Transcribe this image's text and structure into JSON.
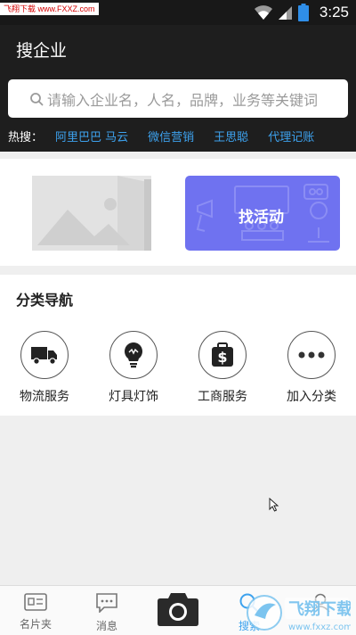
{
  "status_bar": {
    "watermark": "飞翔下载 www.FXXZ.com",
    "time": "3:25",
    "icons": [
      "wifi-icon",
      "signal-icon",
      "battery-icon"
    ]
  },
  "header": {
    "title": "搜企业",
    "search_placeholder": "请输入企业名，人名，品牌，业务等关键词",
    "hot_label": "热搜：",
    "hot_items": [
      "阿里巴巴 马云",
      "微信营销",
      "王思聪",
      "代理记账"
    ]
  },
  "banner": {
    "image_icon": "image-placeholder-icon",
    "activity_label": "找活动"
  },
  "categories": {
    "title": "分类导航",
    "items": [
      {
        "label": "物流服务",
        "icon": "truck-icon"
      },
      {
        "label": "灯具灯饰",
        "icon": "lightbulb-icon"
      },
      {
        "label": "工商服务",
        "icon": "dollar-bag-icon"
      },
      {
        "label": "加入分类",
        "icon": "more-dots-icon"
      }
    ]
  },
  "bottom_nav": {
    "items": [
      {
        "label": "名片夹",
        "icon": "card-icon"
      },
      {
        "label": "消息",
        "icon": "message-icon"
      },
      {
        "label": "",
        "icon": "camera-icon"
      },
      {
        "label": "搜索",
        "icon": "search-icon"
      },
      {
        "label": "",
        "icon": "user-icon"
      }
    ],
    "watermark": "飞翔下载 www.fxxz.com"
  },
  "colors": {
    "header_bg": "#1e1e1e",
    "accent": "#3da2ee",
    "activity_bg": "#6f72f0"
  }
}
